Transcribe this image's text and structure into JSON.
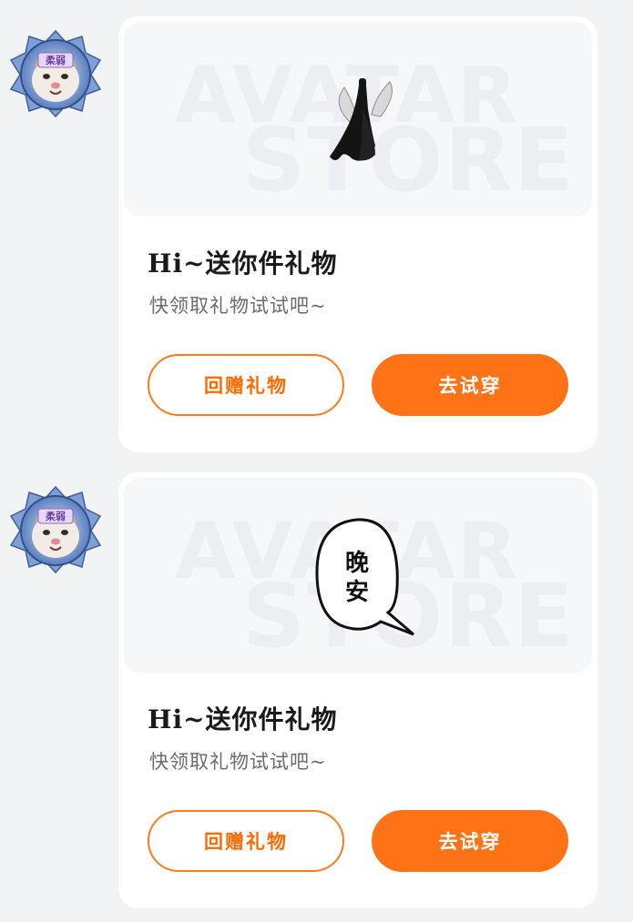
{
  "colors": {
    "page_bg": "#f2f3f5",
    "card_bg": "#ffffff",
    "accent": "#ff7316"
  },
  "messages": [
    {
      "watermark_top": "AVATAR",
      "watermark_bottom": "STORE",
      "gift_icon": "black-dress-outfit-icon",
      "title": "Hi~送你件礼物",
      "subtitle": "快领取礼物试试吧~",
      "return_gift_label": "回赠礼物",
      "try_on_label": "去试穿"
    },
    {
      "watermark_top": "AVATAR",
      "watermark_bottom": "STORE",
      "gift_icon": "speech-bubble-sticker-icon",
      "bubble_text_line1": "晚",
      "bubble_text_line2": "安",
      "title": "Hi~送你件礼物",
      "subtitle": "快领取礼物试试吧~",
      "return_gift_label": "回赠礼物",
      "try_on_label": "去试穿"
    }
  ]
}
